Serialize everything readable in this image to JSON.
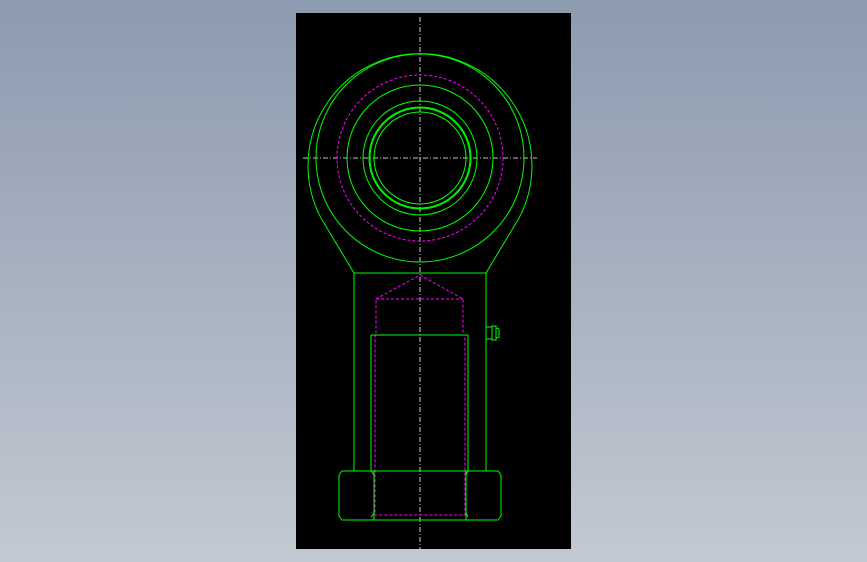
{
  "drawing": {
    "view": "rod-end-front-view",
    "colors": {
      "background": "#000000",
      "outline": "#00ff00",
      "hidden_line": "#ff00ff",
      "centerline": "#ffffff"
    }
  }
}
